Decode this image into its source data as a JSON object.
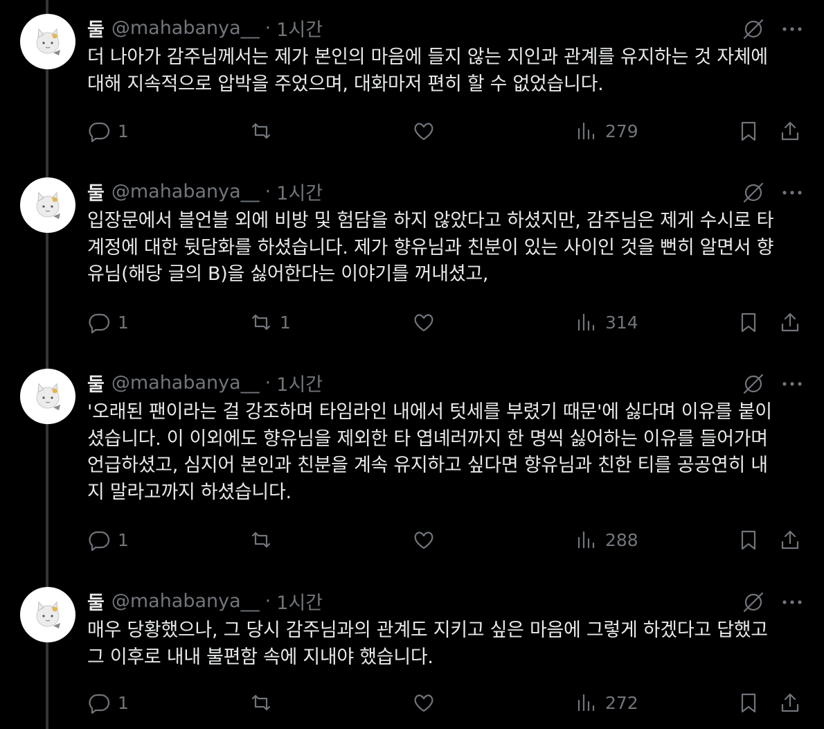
{
  "colors": {
    "background": "#000000",
    "text": "#e7e9ea",
    "muted": "#71767b",
    "thread_line": "#333639"
  },
  "tweets": [
    {
      "name": "둘",
      "handle": "@mahabanya__",
      "dot": "·",
      "time": "1시간",
      "text": "더 나아가 감주님께서는 제가 본인의 마음에 들지 않는 지인과 관계를 유지하는 것 자체에\n대해 지속적으로 압박을 주었으며, 대화마저 편히 할 수 없었습니다.",
      "replies": "1",
      "reposts": "",
      "views": "279"
    },
    {
      "name": "둘",
      "handle": "@mahabanya__",
      "dot": "·",
      "time": "1시간",
      "text": "입장문에서 블언블 외에 비방 및 험담을 하지 않았다고 하셨지만, 감주님은 제게 수시로 타\n계정에 대한 뒷담화를 하셨습니다. 제가 향유님과 친분이 있는 사이인 것을 뻔히 알면서 향\n유님(해당 글의 B)을 싫어한다는 이야기를 꺼내셨고,",
      "replies": "1",
      "reposts": "1",
      "views": "314"
    },
    {
      "name": "둘",
      "handle": "@mahabanya__",
      "dot": "·",
      "time": "1시간",
      "text": "'오래된 팬이라는 걸 강조하며 타임라인 내에서 텃세를 부렸기 때문'에 싫다며 이유를 붙이\n셨습니다. 이 이외에도 향유님을 제외한 타 엽녜러까지 한 명씩 싫어하는 이유를 들어가며\n언급하셨고, 심지어 본인과 친분을 계속 유지하고 싶다면 향유님과 친한 티를 공공연히 내\n지 말라고까지 하셨습니다.",
      "replies": "1",
      "reposts": "",
      "views": "288"
    },
    {
      "name": "둘",
      "handle": "@mahabanya__",
      "dot": "·",
      "time": "1시간",
      "text": "매우 당황했으나, 그 당시 감주님과의 관계도 지키고 싶은 마음에 그렇게 하겠다고 답했고\n그 이후로 내내 불편함 속에 지내야 했습니다.",
      "replies": "1",
      "reposts": "",
      "views": "272"
    }
  ],
  "icons": {
    "reply": "reply-icon",
    "repost": "repost-icon",
    "like": "like-icon",
    "views": "views-icon",
    "bookmark": "bookmark-icon",
    "share": "share-icon",
    "grok": "grok-icon",
    "more": "more-icon"
  }
}
